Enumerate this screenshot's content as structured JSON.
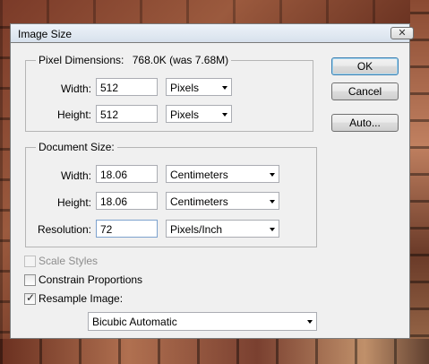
{
  "window": {
    "title": "Image Size",
    "close_glyph": "✕"
  },
  "pixel_dimensions": {
    "label": "Pixel Dimensions:",
    "value": "768.0K (was 7.68M)",
    "width_label": "Width:",
    "width_value": "512",
    "width_unit": "Pixels",
    "height_label": "Height:",
    "height_value": "512",
    "height_unit": "Pixels"
  },
  "document_size": {
    "label": "Document Size:",
    "width_label": "Width:",
    "width_value": "18.06",
    "width_unit": "Centimeters",
    "height_label": "Height:",
    "height_value": "18.06",
    "height_unit": "Centimeters",
    "resolution_label": "Resolution:",
    "resolution_value": "72",
    "resolution_unit": "Pixels/Inch"
  },
  "options": {
    "scale_styles": {
      "label": "Scale Styles",
      "checked": false,
      "enabled": false
    },
    "constrain_proportions": {
      "label": "Constrain Proportions",
      "checked": false,
      "enabled": true
    },
    "resample_image": {
      "label": "Resample Image:",
      "checked": true,
      "enabled": true,
      "method": "Bicubic Automatic",
      "check_glyph": "✓"
    }
  },
  "buttons": {
    "ok": "OK",
    "cancel": "Cancel",
    "auto": "Auto..."
  }
}
